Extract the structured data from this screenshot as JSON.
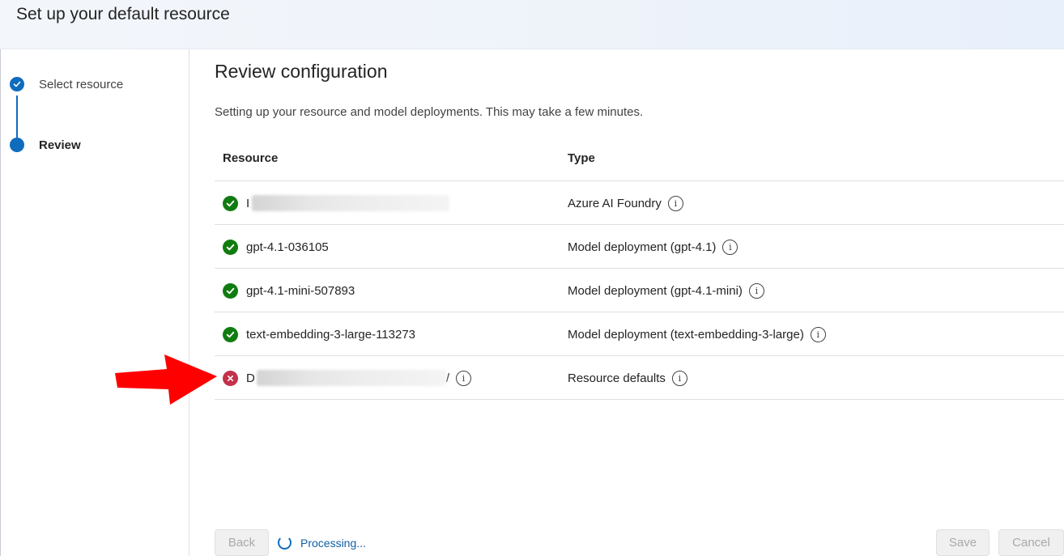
{
  "header": {
    "title": "Set up your default resource"
  },
  "steps": [
    {
      "label": "Select resource",
      "state": "completed"
    },
    {
      "label": "Review",
      "state": "current"
    }
  ],
  "main": {
    "title": "Review configuration",
    "description": "Setting up your resource and model deployments. This may take a few minutes."
  },
  "table": {
    "headers": {
      "resource": "Resource",
      "type": "Type"
    },
    "rows": [
      {
        "status": "success",
        "name": "I",
        "type": "Azure AI Foundry"
      },
      {
        "status": "success",
        "name": "gpt-4.1-036105",
        "type": "Model deployment (gpt-4.1)"
      },
      {
        "status": "success",
        "name": "gpt-4.1-mini-507893",
        "type": "Model deployment (gpt-4.1-mini)"
      },
      {
        "status": "success",
        "name": "text-embedding-3-large-113273",
        "type": "Model deployment (text-embedding-3-large)"
      },
      {
        "status": "error",
        "name": "D",
        "name_suffix": "/",
        "type": "Resource defaults"
      }
    ]
  },
  "footer": {
    "back_label": "Back",
    "processing_label": "Processing...",
    "save_label": "Save",
    "cancel_label": "Cancel"
  },
  "colors": {
    "accent": "#0f6cbd",
    "success": "#107c10",
    "error": "#c4314b",
    "annotation_arrow": "#ff0000"
  }
}
